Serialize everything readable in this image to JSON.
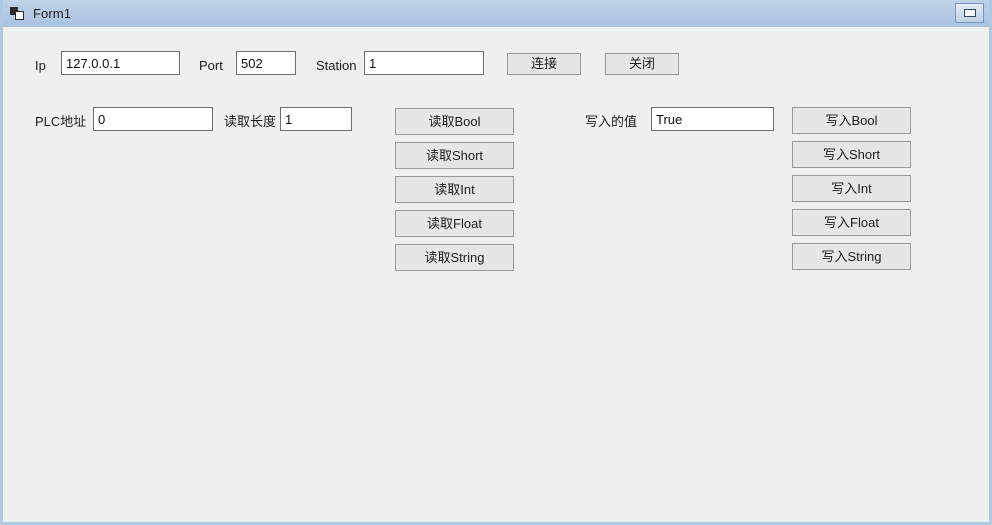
{
  "window": {
    "title": "Form1",
    "icon": "winforms-icon",
    "restore_button_label": "",
    "titlebar_color": "#b4cae4",
    "client_color": "#efefef",
    "border_color": "#b0c9e3"
  },
  "connection_row": {
    "ip_label": "Ip",
    "ip_value": "127.0.0.1",
    "port_label": "Port",
    "port_value": "502",
    "station_label": "Station",
    "station_value": "1",
    "connect_button": "连接",
    "close_button": "关闭"
  },
  "address_row": {
    "plc_address_label": "PLC地址",
    "plc_address_value": "0",
    "read_length_label": "读取长度",
    "read_length_value": "1"
  },
  "write_value": {
    "label": "写入的值",
    "value": "True"
  },
  "read_buttons": [
    {
      "label": "读取Bool"
    },
    {
      "label": "读取Short"
    },
    {
      "label": "读取Int"
    },
    {
      "label": "读取Float"
    },
    {
      "label": "读取String"
    }
  ],
  "write_buttons": [
    {
      "label": "写入Bool"
    },
    {
      "label": "写入Short"
    },
    {
      "label": "写入Int"
    },
    {
      "label": "写入Float"
    },
    {
      "label": "写入String"
    }
  ]
}
